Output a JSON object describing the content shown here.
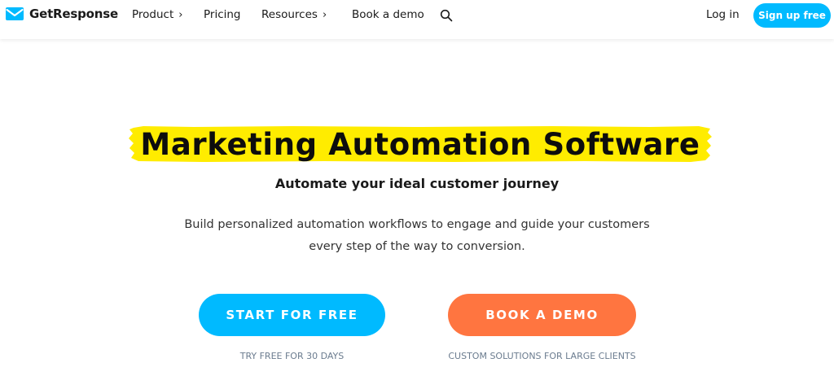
{
  "header": {
    "brand": "GetResponse",
    "logo_icon": "envelope-logo-icon",
    "nav": [
      {
        "label": "Product",
        "chevron": "›"
      },
      {
        "label": "Pricing"
      },
      {
        "label": "Resources",
        "chevron": "›"
      },
      {
        "label": "Book a demo"
      }
    ],
    "search_icon": "search-icon",
    "login_label": "Log in",
    "signup_label": "Sign up free"
  },
  "hero": {
    "title": "Marketing Automation Software",
    "subtitle": "Automate your ideal customer journey",
    "description": "Build personalized automation workflows to engage and guide your customers every step of the way to conversion.",
    "cta_primary": {
      "label": "START FOR FREE",
      "note": "TRY FREE FOR 30 DAYS"
    },
    "cta_secondary": {
      "label": "BOOK A DEMO",
      "note": "CUSTOM SOLUTIONS FOR LARGE CLIENTS"
    }
  },
  "colors": {
    "accent_blue": "#00baff",
    "accent_orange": "#ff7540",
    "highlight_yellow": "#ffec00"
  }
}
